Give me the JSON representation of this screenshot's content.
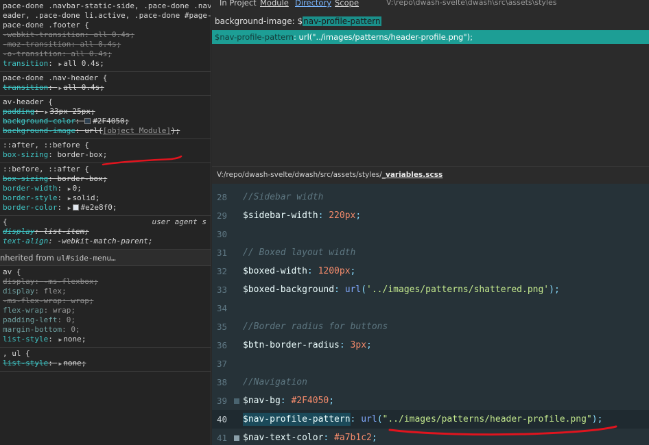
{
  "devtools": {
    "rules": [
      {
        "lines": [
          {
            "text": "pace-done .navbar-static-side, .pace-done .nav-"
          },
          {
            "text": "eader, .pace-done li.active, .pace-done #page-wr"
          },
          {
            "text": "pace-done .footer {"
          }
        ],
        "decls": [
          {
            "prop": "-webkit-transition",
            "val": "all 0.4s",
            "struck": true,
            "disabled": true
          },
          {
            "prop": "-moz-transition",
            "val": "all 0.4s",
            "struck": true,
            "disabled": true
          },
          {
            "prop": "-o-transition",
            "val": "all 0.4s",
            "struck": true,
            "disabled": true
          },
          {
            "prop": "transition",
            "val": "all 0.4s",
            "arrow": true
          }
        ]
      },
      {
        "lines": [
          {
            "text": "pace-done .nav-header {"
          }
        ],
        "decls": [
          {
            "prop": "transition",
            "val": "all 0.4s",
            "struck": true,
            "arrow": true
          }
        ]
      },
      {
        "lines": [
          {
            "text": "av-header {"
          }
        ],
        "decls": [
          {
            "prop": "padding",
            "val": "33px 25px",
            "struck": true,
            "arrow": true
          },
          {
            "prop": "background-color",
            "val": "#2F4050",
            "struck": true,
            "swatch": "#2F4050"
          },
          {
            "prop": "background-image",
            "val_prefix": "url(",
            "val_link": "[object Module]",
            "val_suffix": ");",
            "struck": true
          }
        ]
      },
      {
        "lines": [
          {
            "text": " ::after, ::before {"
          }
        ],
        "decls": [
          {
            "prop": "box-sizing",
            "val": "border-box"
          }
        ]
      },
      {
        "lines": [
          {
            "text": " ::before, ::after {"
          }
        ],
        "decls": [
          {
            "prop": "box-sizing",
            "val": "border-box",
            "struck": true
          },
          {
            "prop": "border-width",
            "val": "0",
            "arrow": true
          },
          {
            "prop": "border-style",
            "val": "solid",
            "arrow": true
          },
          {
            "prop": "border-color",
            "val": "#e2e8f0",
            "arrow": true,
            "swatch": "#e2e8f0"
          }
        ]
      },
      {
        "lines": [
          {
            "text": " {",
            "ua": "user agent s"
          }
        ],
        "italic": true,
        "decls": [
          {
            "prop": "display",
            "val": "list-item",
            "struck": true
          },
          {
            "prop": "text-align",
            "val": "-webkit-match-parent"
          }
        ]
      }
    ],
    "inherited": {
      "label": "nherited from ",
      "source": "ul#side-menu…"
    },
    "rules2": [
      {
        "lines": [
          {
            "text": "av {"
          }
        ],
        "decls": [
          {
            "prop": "display",
            "val": "-ms-flexbox",
            "struck": true,
            "disabled": true
          },
          {
            "prop": "display",
            "val": "flex",
            "dim": true
          },
          {
            "prop": "-ms-flex-wrap",
            "val": "wrap",
            "struck": true,
            "disabled": true
          },
          {
            "prop": "flex-wrap",
            "val": "wrap",
            "dim": true
          },
          {
            "prop": "padding-left",
            "val": "0",
            "dim": true
          },
          {
            "prop": "margin-bottom",
            "val": "0",
            "dim": true
          },
          {
            "prop": "list-style",
            "val": "none",
            "arrow": true
          }
        ]
      },
      {
        "lines": [
          {
            "text": ", ul {"
          }
        ],
        "decls": [
          {
            "prop": "list-style",
            "val": "none",
            "struck": true,
            "arrow": true
          }
        ]
      }
    ]
  },
  "find_panel": {
    "tabs": [
      "In Project",
      "Module",
      "Directory",
      "Scope"
    ],
    "active_tab": "Directory",
    "directory_path": "V:\\repo\\dwash-svelte\\dwash\\src\\assets\\styles",
    "query_prefix": "background-image: $",
    "query_match": "nav-profile-pattern",
    "result_match": "$nav-profile-pattern",
    "result_rest": ": url(\"../images/patterns/header-profile.png\");"
  },
  "editor": {
    "file_dir": "V:/repo/dwash-svelte/dwash/src/assets/styles/",
    "file_name": "_variables.scss",
    "current_line": 40,
    "lines": [
      {
        "n": "28",
        "tokens": [
          {
            "c": "cm",
            "t": "//Sidebar width"
          }
        ]
      },
      {
        "n": "29",
        "tokens": [
          {
            "c": "var",
            "t": "$sidebar-width"
          },
          {
            "c": "pun",
            "t": ": "
          },
          {
            "c": "num",
            "t": "220px"
          },
          {
            "c": "pun",
            "t": ";"
          }
        ]
      },
      {
        "n": "30",
        "tokens": []
      },
      {
        "n": "31",
        "tokens": [
          {
            "c": "cm",
            "t": "// Boxed layout width"
          }
        ]
      },
      {
        "n": "32",
        "tokens": [
          {
            "c": "var",
            "t": "$boxed-width"
          },
          {
            "c": "pun",
            "t": ": "
          },
          {
            "c": "num",
            "t": "1200px"
          },
          {
            "c": "pun",
            "t": ";"
          }
        ]
      },
      {
        "n": "33",
        "tokens": [
          {
            "c": "var",
            "t": "$boxed-background"
          },
          {
            "c": "pun",
            "t": ": "
          },
          {
            "c": "fn",
            "t": "url"
          },
          {
            "c": "pun",
            "t": "("
          },
          {
            "c": "str",
            "t": "'../images/patterns/shattered.png'"
          },
          {
            "c": "pun",
            "t": ");"
          }
        ]
      },
      {
        "n": "34",
        "tokens": []
      },
      {
        "n": "35",
        "tokens": [
          {
            "c": "cm",
            "t": "//Border radius for buttons"
          }
        ]
      },
      {
        "n": "36",
        "tokens": [
          {
            "c": "var",
            "t": "$btn-border-radius"
          },
          {
            "c": "pun",
            "t": ": "
          },
          {
            "c": "num",
            "t": "3px"
          },
          {
            "c": "pun",
            "t": ";"
          }
        ]
      },
      {
        "n": "37",
        "tokens": []
      },
      {
        "n": "38",
        "tokens": [
          {
            "c": "cm",
            "t": "//Navigation"
          }
        ]
      },
      {
        "n": "39",
        "gutter": "dark",
        "tokens": [
          {
            "c": "var",
            "t": "$nav-bg"
          },
          {
            "c": "pun",
            "t": ": "
          },
          {
            "c": "num",
            "t": "#2F4050"
          },
          {
            "c": "pun",
            "t": ";"
          }
        ]
      },
      {
        "n": "40",
        "tokens": [
          {
            "c": "var hlv",
            "t": "$nav-profile-pattern"
          },
          {
            "c": "pun",
            "t": ": "
          },
          {
            "c": "fn",
            "t": "url"
          },
          {
            "c": "pun",
            "t": "("
          },
          {
            "c": "str",
            "t": "\"../images/patterns/header-profile.png\""
          },
          {
            "c": "pun",
            "t": ");"
          }
        ]
      },
      {
        "n": "41",
        "gutter": "light",
        "tokens": [
          {
            "c": "var",
            "t": "$nav-text-color"
          },
          {
            "c": "pun",
            "t": ": "
          },
          {
            "c": "num",
            "t": "#a7b1c2"
          },
          {
            "c": "pun",
            "t": ";"
          }
        ]
      }
    ]
  },
  "annotation_color": "#e0141e"
}
